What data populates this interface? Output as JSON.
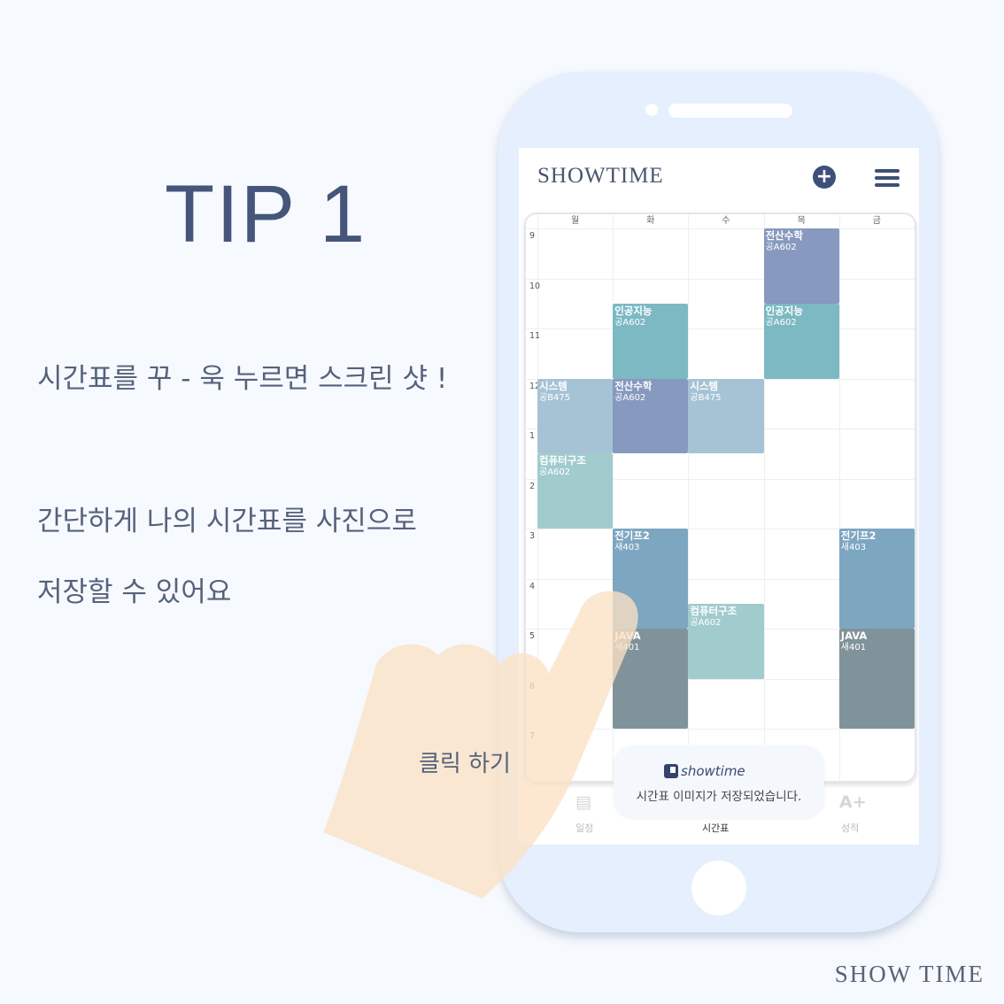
{
  "tip": {
    "title": "TIP 1",
    "line1": "시간표를 꾸 - 욱 누르면 스크린 샷 !",
    "line2": "간단하게 나의 시간표를 사진으로",
    "line3": "저장할 수 있어요",
    "click_label": "클릭 하기"
  },
  "footer_brand": "SHOW TIME",
  "app": {
    "logo": "SHOWTIME",
    "add_icon": "plus-circle-icon",
    "menu_icon": "hamburger-menu-icon",
    "days": [
      "월",
      "화",
      "수",
      "목",
      "금"
    ],
    "hours": [
      "9",
      "10",
      "11",
      "12",
      "1",
      "2",
      "3",
      "4",
      "5",
      "6",
      "7"
    ],
    "classes": [
      {
        "name": "전산수학",
        "room": "공A602",
        "day": 3,
        "start": 0,
        "end": 1.5,
        "color": "#8799be"
      },
      {
        "name": "인공지능",
        "room": "공A602",
        "day": 1,
        "start": 1.5,
        "end": 3,
        "color": "#7cb9c3"
      },
      {
        "name": "인공지능",
        "room": "공A602",
        "day": 3,
        "start": 1.5,
        "end": 3,
        "color": "#7cb9c3"
      },
      {
        "name": "시스템",
        "room": "공B475",
        "day": 0,
        "start": 3,
        "end": 4.5,
        "color": "#a6c3d6"
      },
      {
        "name": "전산수학",
        "room": "공A602",
        "day": 1,
        "start": 3,
        "end": 4.5,
        "color": "#8799be"
      },
      {
        "name": "시스템",
        "room": "공B475",
        "day": 2,
        "start": 3,
        "end": 4.5,
        "color": "#a6c3d6"
      },
      {
        "name": "컴퓨터구조",
        "room": "공A602",
        "day": 0,
        "start": 4.5,
        "end": 6,
        "color": "#a2cbce"
      },
      {
        "name": "전기프2",
        "room": "새403",
        "day": 1,
        "start": 6,
        "end": 8,
        "color": "#7da6c1"
      },
      {
        "name": "전기프2",
        "room": "새403",
        "day": 4,
        "start": 6,
        "end": 8,
        "color": "#7da6c1"
      },
      {
        "name": "컴퓨터구조",
        "room": "공A602",
        "day": 2,
        "start": 7.5,
        "end": 9,
        "color": "#a2cbce"
      },
      {
        "name": "JAVA",
        "room": "새401",
        "day": 1,
        "start": 8,
        "end": 10,
        "color": "#80939a"
      },
      {
        "name": "JAVA",
        "room": "새401",
        "day": 4,
        "start": 8,
        "end": 10,
        "color": "#80939a"
      }
    ],
    "nav": [
      {
        "label": "일정",
        "icon": "calendar-icon",
        "active": false
      },
      {
        "label": "시간표",
        "icon": "timetable-icon",
        "active": true
      },
      {
        "label": "성적",
        "icon": "grade-a-plus-icon",
        "active": false
      }
    ],
    "toast": {
      "brand": "showtime",
      "message": "시간표 이미지가 저장되었습니다."
    }
  }
}
